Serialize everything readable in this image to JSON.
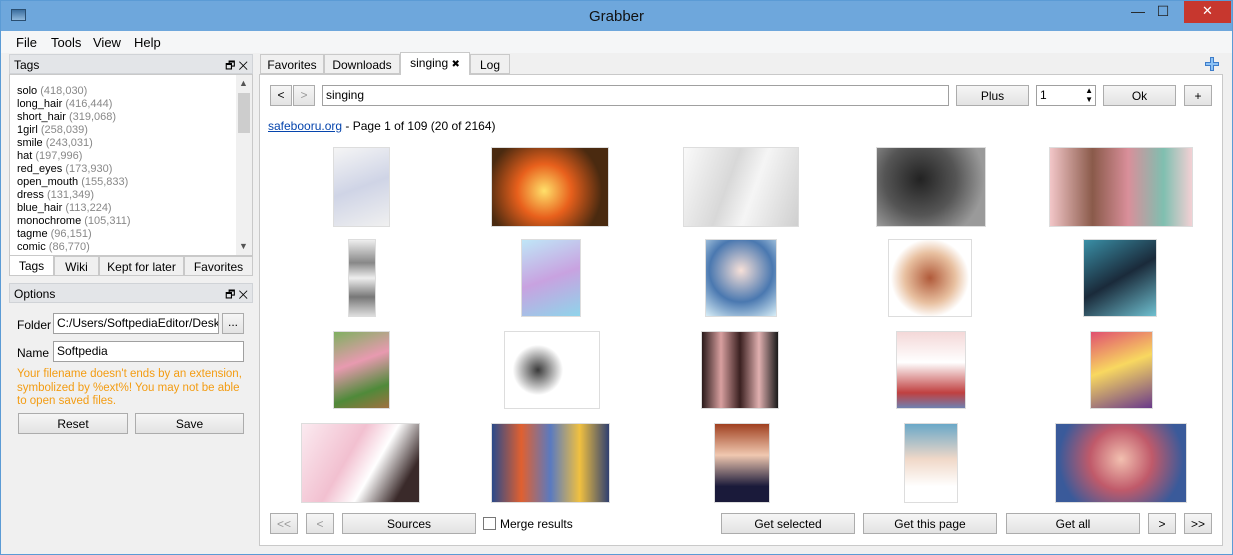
{
  "window": {
    "title": "Grabber"
  },
  "menu": [
    "File",
    "Tools",
    "View",
    "Help"
  ],
  "tags_panel": {
    "title": "Tags",
    "items": [
      {
        "name": "solo",
        "count": "(418,030)"
      },
      {
        "name": "long_hair",
        "count": "(416,444)"
      },
      {
        "name": "short_hair",
        "count": "(319,068)"
      },
      {
        "name": "1girl",
        "count": "(258,039)"
      },
      {
        "name": "smile",
        "count": "(243,031)"
      },
      {
        "name": "hat",
        "count": "(197,996)"
      },
      {
        "name": "red_eyes",
        "count": "(173,930)"
      },
      {
        "name": "open_mouth",
        "count": "(155,833)"
      },
      {
        "name": "dress",
        "count": "(131,349)"
      },
      {
        "name": "blue_hair",
        "count": "(113,224)"
      },
      {
        "name": "monochrome",
        "count": "(105,311)"
      },
      {
        "name": "tagme",
        "count": "(96,151)"
      },
      {
        "name": "comic",
        "count": "(86,770)"
      }
    ],
    "tabs": [
      "Tags",
      "Wiki",
      "Kept for later",
      "Favorites"
    ]
  },
  "options_panel": {
    "title": "Options",
    "folder_label": "Folder",
    "folder_value": "C:/Users/SoftpediaEditor/Desktop",
    "browse_label": "...",
    "name_label": "Name",
    "name_value": "Softpedia",
    "warning": "Your filename doesn't ends by an extension, symbolized by %ext%! You may not be able to open saved files.",
    "reset_label": "Reset",
    "save_label": "Save"
  },
  "main_tabs": [
    {
      "label": "Favorites"
    },
    {
      "label": "Downloads"
    },
    {
      "label": "singing",
      "close": "✖"
    },
    {
      "label": "Log"
    }
  ],
  "search": {
    "prev": "<",
    "next": ">",
    "query": "singing",
    "plus_label": "Plus",
    "page_value": "1",
    "ok_label": "Ok",
    "add_label": "+"
  },
  "results": {
    "source_link": "safebooru.org",
    "info": " - Page 1 of 109 (20 of 2164)"
  },
  "bottom": {
    "first": "<<",
    "prev": "<",
    "sources": "Sources",
    "merge": "Merge results",
    "get_selected": "Get selected",
    "get_page": "Get this page",
    "get_all": "Get all",
    "next": ">",
    "last": ">>"
  },
  "colors": {
    "titlebar": "#6ea7dc",
    "close": "#c7372e",
    "warning": "#f39c12",
    "link": "#0645ad"
  }
}
